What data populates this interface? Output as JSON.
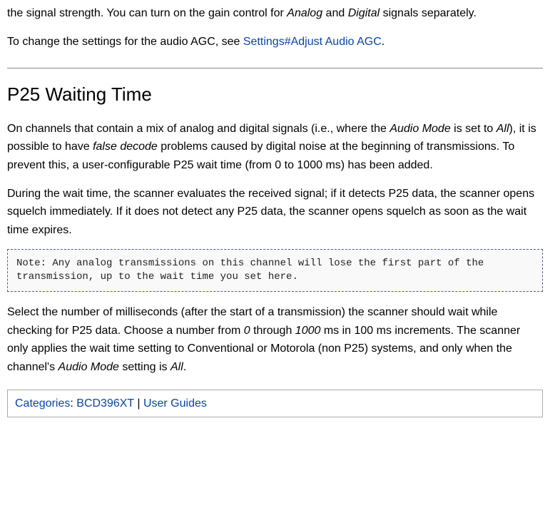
{
  "intro": {
    "p1_pre": "the signal strength. You can turn on the gain control for ",
    "p1_em1": "Analog",
    "p1_mid1": " and ",
    "p1_em2": "Digital",
    "p1_post": " signals separately.",
    "p2_pre": "To change the settings for the audio AGC, see ",
    "p2_link": "Settings#Adjust Audio AGC",
    "p2_post": "."
  },
  "section": {
    "heading": "P25 Waiting Time",
    "p1_pre": "On channels that contain a mix of analog and digital signals (i.e., where the ",
    "p1_em1": "Audio Mode",
    "p1_mid1": " is set to ",
    "p1_em2": "All",
    "p1_mid2": "), it is possible to have ",
    "p1_em3": "false decode",
    "p1_post": " problems caused by digital noise at the beginning of transmissions. To prevent this, a user-configurable P25 wait time (from 0 to 1000 ms) has been added.",
    "p2": "During the wait time, the scanner evaluates the received signal; if it detects P25 data, the scanner opens squelch immediately. If it does not detect any P25 data, the scanner opens squelch as soon as the wait time expires.",
    "note": "Note: Any analog transmissions on this channel will lose the first part of the transmission, up to the wait time you set here.",
    "p3_pre": "Select the number of milliseconds (after the start of a transmission) the scanner should wait while checking for P25 data. Choose a number from ",
    "p3_em1": "0",
    "p3_mid1": " through ",
    "p3_em2": "1000",
    "p3_mid2": " ms in 100 ms increments. The scanner only applies the wait time setting to Conventional or Motorola (non P25) systems, and only when the channel's ",
    "p3_em3": "Audio Mode",
    "p3_mid3": " setting is ",
    "p3_em4": "All",
    "p3_post": "."
  },
  "categories": {
    "label": "Categories",
    "sep1": ": ",
    "link1": "BCD396XT",
    "sep2": " | ",
    "link2": "User Guides"
  }
}
